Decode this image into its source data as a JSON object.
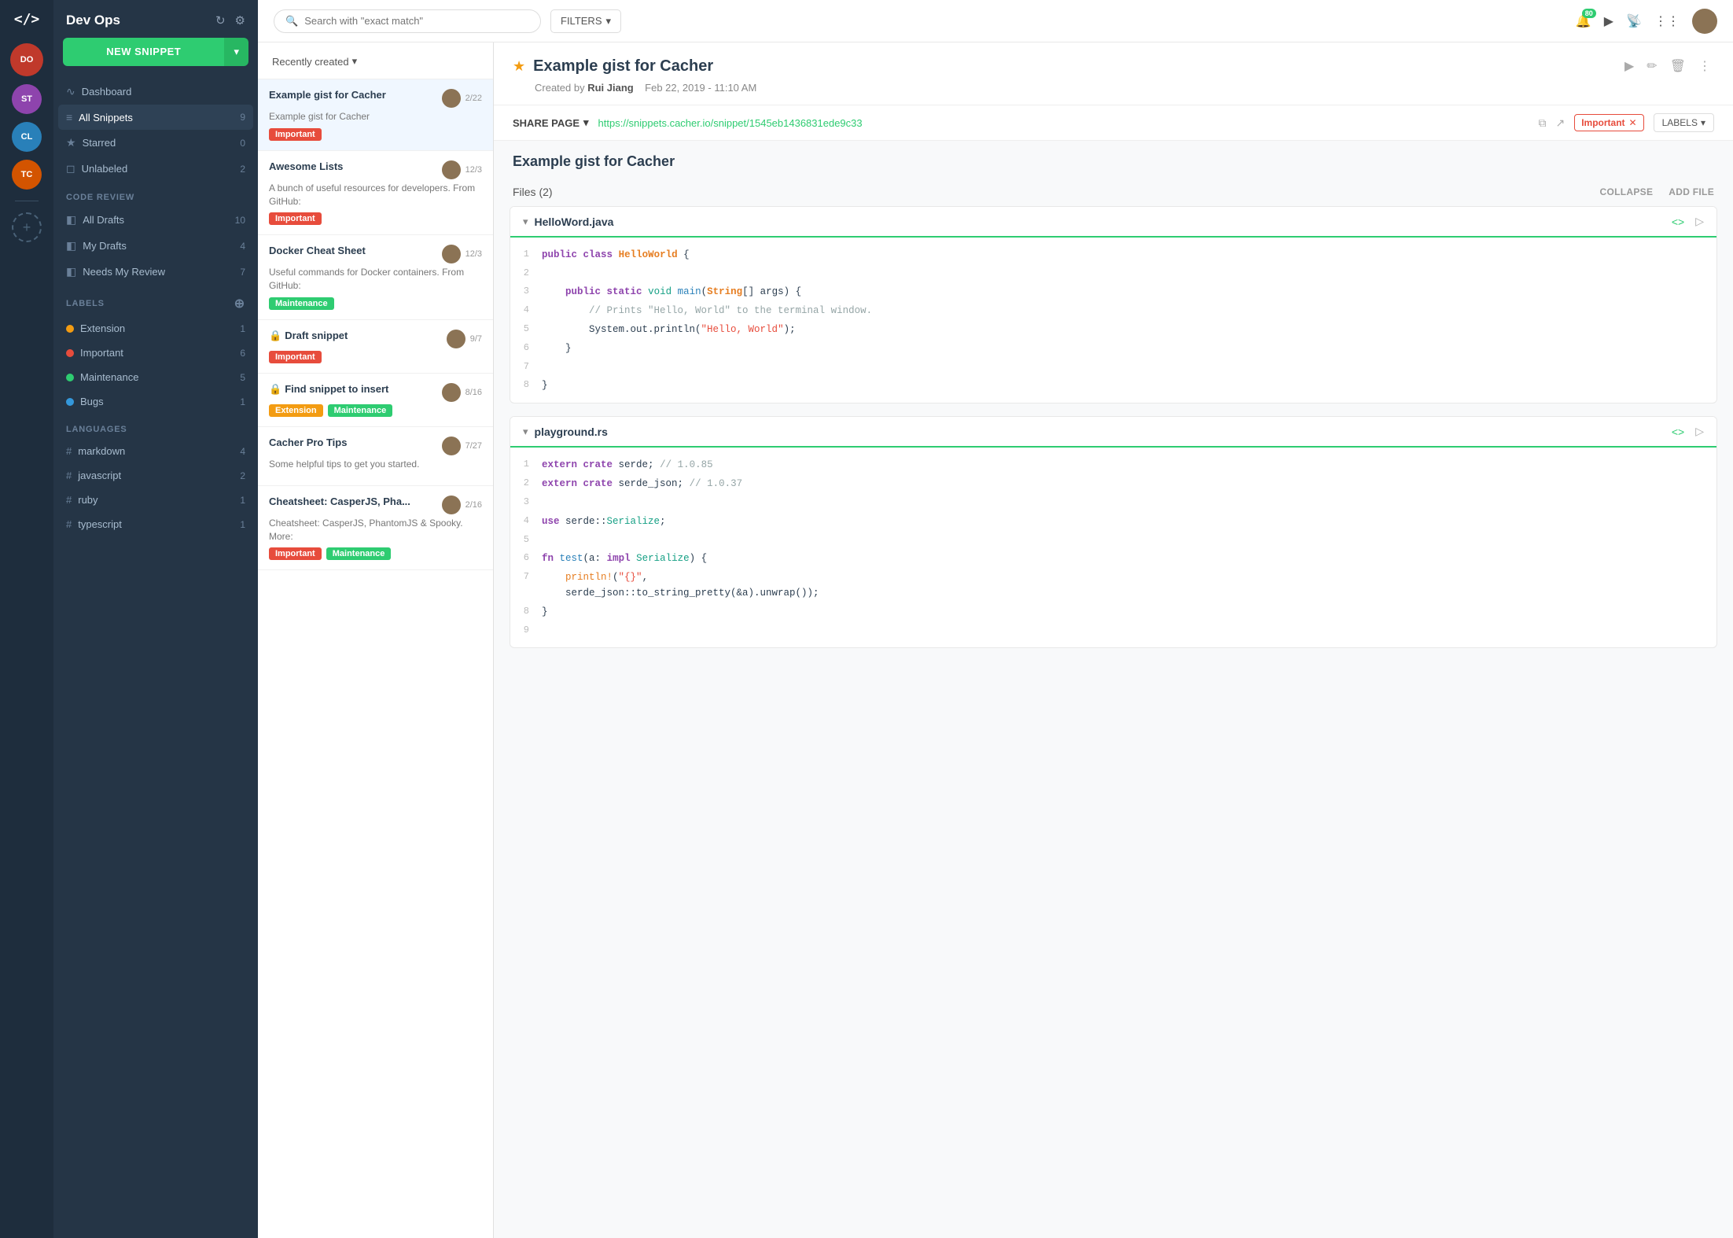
{
  "app": {
    "logo": "</>",
    "workspace": "Dev Ops"
  },
  "avatar_strip": {
    "avatars": [
      {
        "initials": "DO",
        "color": "#e74c3c",
        "tooltip": "Dev Ops"
      },
      {
        "initials": "ST",
        "color": "#9b59b6",
        "tooltip": "Team ST"
      },
      {
        "initials": "CL",
        "color": "#3498db",
        "tooltip": "Team CL"
      },
      {
        "initials": "TC",
        "color": "#e67e22",
        "tooltip": "Team TC"
      }
    ],
    "add_label": "+"
  },
  "sidebar": {
    "workspace_label": "Dev Ops",
    "new_snippet_label": "NEW SNIPPET",
    "nav_items": [
      {
        "icon": "chart",
        "label": "Dashboard",
        "count": null
      },
      {
        "icon": "list",
        "label": "All Snippets",
        "count": 9,
        "active": true
      },
      {
        "icon": "star",
        "label": "Starred",
        "count": 0
      },
      {
        "icon": "tag",
        "label": "Unlabeled",
        "count": 2
      }
    ],
    "code_review_section": "CODE REVIEW",
    "code_review_items": [
      {
        "icon": "draft",
        "label": "All Drafts",
        "count": 10
      },
      {
        "icon": "draft",
        "label": "My Drafts",
        "count": 4
      },
      {
        "icon": "draft",
        "label": "Needs My Review",
        "count": 7
      }
    ],
    "labels_section": "LABELS",
    "labels": [
      {
        "name": "Extension",
        "color": "#f39c12",
        "count": 1
      },
      {
        "name": "Important",
        "color": "#e74c3c",
        "count": 6
      },
      {
        "name": "Maintenance",
        "color": "#2ecc71",
        "count": 5
      },
      {
        "name": "Bugs",
        "color": "#3498db",
        "count": 1
      }
    ],
    "languages_section": "LANGUAGES",
    "languages": [
      {
        "name": "markdown",
        "count": 4
      },
      {
        "name": "javascript",
        "count": 2
      },
      {
        "name": "ruby",
        "count": 1
      },
      {
        "name": "typescript",
        "count": 1
      }
    ]
  },
  "search": {
    "placeholder": "Search with \"exact match\"",
    "filters_label": "FILTERS"
  },
  "header": {
    "badge_count": "80",
    "user_avatar_alt": "User avatar"
  },
  "snippet_list": {
    "sort_label": "Recently created",
    "items": [
      {
        "title": "Example gist for Cacher",
        "desc": "Example gist for Cacher",
        "date": "2/22",
        "tags": [
          {
            "label": "Important",
            "class": "tag-important"
          }
        ],
        "locked": false,
        "active": true
      },
      {
        "title": "Awesome Lists",
        "desc": "A bunch of useful resources for developers. From GitHub:",
        "date": "12/3",
        "tags": [
          {
            "label": "Important",
            "class": "tag-important"
          }
        ],
        "locked": false,
        "active": false
      },
      {
        "title": "Docker Cheat Sheet",
        "desc": "Useful commands for Docker containers. From GitHub:",
        "date": "12/3",
        "tags": [
          {
            "label": "Maintenance",
            "class": "tag-maintenance"
          }
        ],
        "locked": false,
        "active": false
      },
      {
        "title": "Draft snippet",
        "desc": "",
        "date": "9/7",
        "tags": [
          {
            "label": "Important",
            "class": "tag-important"
          }
        ],
        "locked": true,
        "active": false
      },
      {
        "title": "Find snippet to insert",
        "desc": "",
        "date": "8/16",
        "tags": [
          {
            "label": "Extension",
            "class": "tag-extension"
          },
          {
            "label": "Maintenance",
            "class": "tag-maintenance"
          }
        ],
        "locked": true,
        "active": false
      },
      {
        "title": "Cacher Pro Tips",
        "desc": "Some helpful tips to get you started.",
        "date": "7/27",
        "tags": [],
        "locked": false,
        "active": false
      },
      {
        "title": "Cheatsheet: CasperJS, Pha...",
        "desc": "Cheatsheet: CasperJS, PhantomJS & Spooky. More:",
        "date": "2/16",
        "tags": [
          {
            "label": "Important",
            "class": "tag-important"
          },
          {
            "label": "Maintenance",
            "class": "tag-maintenance"
          }
        ],
        "locked": false,
        "active": false
      }
    ]
  },
  "detail": {
    "title": "Example gist for Cacher",
    "author": "Rui Jiang",
    "date": "Feb 22, 2019 - 11:10 AM",
    "share_page_label": "SHARE PAGE",
    "share_url": "https://snippets.cacher.io/snippet/1545eb1436831ede9c33",
    "label_name": "Important",
    "labels_label": "LABELS",
    "snippet_title": "Example gist for Cacher",
    "files_count_label": "Files (2)",
    "collapse_label": "COLLAPSE",
    "add_file_label": "ADD FILE",
    "files": [
      {
        "name": "HelloWord.java",
        "lines": [
          {
            "num": 1,
            "content": "public class HelloWorld {"
          },
          {
            "num": 2,
            "content": ""
          },
          {
            "num": 3,
            "content": "    public static void main(String[] args) {"
          },
          {
            "num": 4,
            "content": "        // Prints \"Hello, World\" to the terminal window."
          },
          {
            "num": 5,
            "content": "        System.out.println(\"Hello, World\");"
          },
          {
            "num": 6,
            "content": "    }"
          },
          {
            "num": 7,
            "content": ""
          },
          {
            "num": 8,
            "content": "}"
          }
        ]
      },
      {
        "name": "playground.rs",
        "lines": [
          {
            "num": 1,
            "content": "extern crate serde; // 1.0.85"
          },
          {
            "num": 2,
            "content": "extern crate serde_json; // 1.0.37"
          },
          {
            "num": 3,
            "content": ""
          },
          {
            "num": 4,
            "content": "use serde::Serialize;"
          },
          {
            "num": 5,
            "content": ""
          },
          {
            "num": 6,
            "content": "fn test(a: impl Serialize) {"
          },
          {
            "num": 7,
            "content": "    println!(\"{}\",\n    serde_json::to_string_pretty(&a).unwrap());"
          },
          {
            "num": 8,
            "content": "}"
          },
          {
            "num": 9,
            "content": ""
          }
        ]
      }
    ]
  }
}
